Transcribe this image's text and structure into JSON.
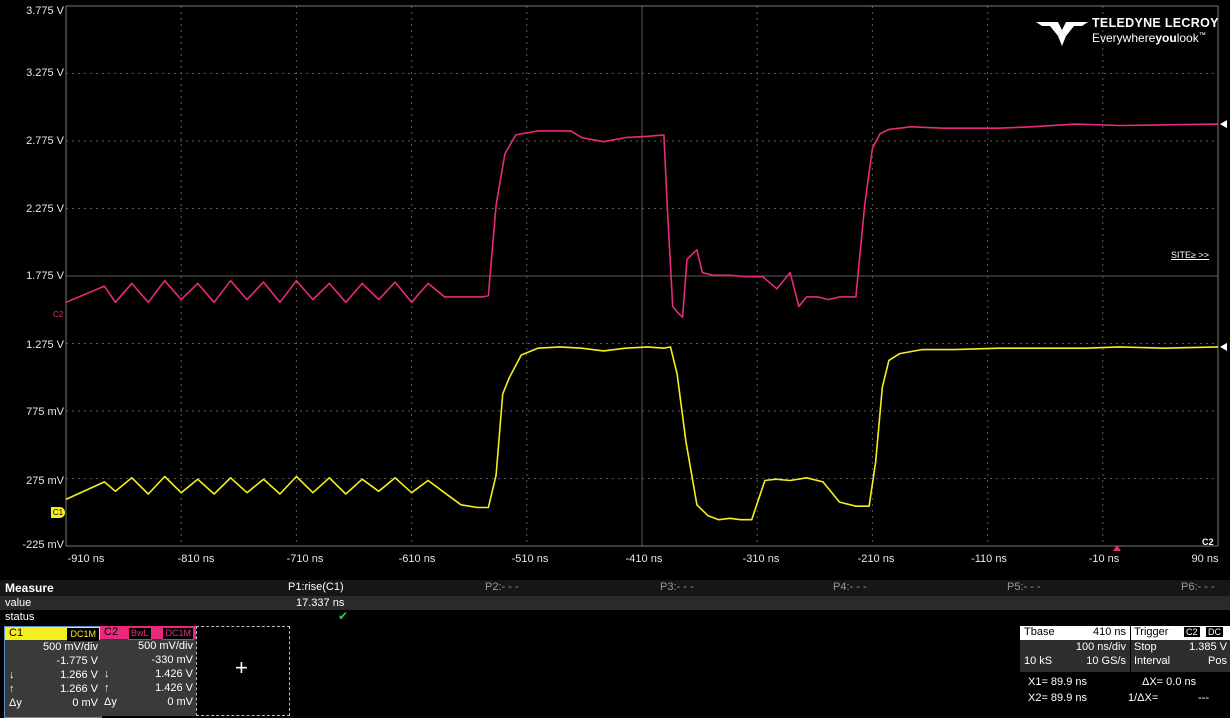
{
  "brand": {
    "name": "TELEDYNE LECROY",
    "tagline_pre": "Everywhere",
    "tagline_bold": "you",
    "tagline_post": "look",
    "tm": "™"
  },
  "axes": {
    "y_labels": [
      "3.775 V",
      "3.275 V",
      "2.775 V",
      "2.275 V",
      "1.775 V",
      "1.275 V",
      "775 mV",
      "275 mV",
      "-225 mV"
    ],
    "x_labels": [
      "-910 ns",
      "-810 ns",
      "-710 ns",
      "-610 ns",
      "-510 ns",
      "-410 ns",
      "-310 ns",
      "-210 ns",
      "-110 ns",
      "-10 ns",
      "90 ns"
    ]
  },
  "grid_link": "SITE≥ >>",
  "c2_tag": "C2",
  "c1_marker": "C1",
  "c2_marker": "C2",
  "colors": {
    "c1": "#f5ef1f",
    "c2": "#e8297e",
    "grid": "#5a5a5a"
  },
  "chart_data": {
    "type": "line",
    "xlabel": "",
    "ylabel": "",
    "x_unit": "ns",
    "xlim": [
      -960,
      90
    ],
    "ylim": [
      -0.225,
      3.775
    ],
    "grid": true,
    "series": [
      {
        "color": "#f5ef1f",
        "x": [
          -960,
          -925,
          -915,
          -900,
          -885,
          -870,
          -855,
          -840,
          -825,
          -810,
          -795,
          -780,
          -765,
          -750,
          -735,
          -720,
          -705,
          -690,
          -675,
          -660,
          -645,
          -630,
          -615,
          -600,
          -585,
          -575,
          -568,
          -562,
          -556,
          -545,
          -530,
          -510,
          -490,
          -470,
          -450,
          -430,
          -415,
          -409,
          -403,
          -395,
          -385,
          -375,
          -365,
          -355,
          -345,
          -335,
          -323,
          -313,
          -300,
          -285,
          -270,
          -255,
          -240,
          -228,
          -222,
          -216,
          -210,
          -200,
          -180,
          -150,
          -110,
          -70,
          -30,
          0,
          40,
          90
        ],
        "y": [
          0.12,
          0.25,
          0.18,
          0.28,
          0.16,
          0.29,
          0.17,
          0.27,
          0.16,
          0.28,
          0.17,
          0.27,
          0.16,
          0.29,
          0.17,
          0.28,
          0.16,
          0.27,
          0.18,
          0.28,
          0.17,
          0.26,
          0.17,
          0.08,
          0.06,
          0.06,
          0.3,
          0.9,
          1.02,
          1.19,
          1.24,
          1.25,
          1.24,
          1.22,
          1.24,
          1.25,
          1.24,
          1.25,
          1.05,
          0.55,
          0.08,
          0.0,
          -0.03,
          -0.02,
          -0.03,
          -0.03,
          0.26,
          0.27,
          0.26,
          0.28,
          0.25,
          0.1,
          0.07,
          0.07,
          0.4,
          0.95,
          1.15,
          1.2,
          1.23,
          1.23,
          1.24,
          1.24,
          1.24,
          1.25,
          1.24,
          1.25
        ]
      },
      {
        "color": "#e8297e",
        "x": [
          -960,
          -925,
          -915,
          -900,
          -885,
          -870,
          -855,
          -840,
          -825,
          -810,
          -795,
          -780,
          -765,
          -750,
          -735,
          -720,
          -705,
          -690,
          -675,
          -660,
          -645,
          -630,
          -615,
          -600,
          -585,
          -580,
          -575,
          -568,
          -560,
          -550,
          -530,
          -510,
          -500,
          -490,
          -470,
          -450,
          -430,
          -415,
          -412,
          -407,
          -402,
          -398,
          -394,
          -390,
          -385,
          -380,
          -370,
          -355,
          -340,
          -325,
          -312,
          -300,
          -292,
          -285,
          -275,
          -265,
          -255,
          -240,
          -232,
          -225,
          -218,
          -210,
          -190,
          -160,
          -130,
          -110,
          -80,
          -40,
          0,
          90
        ],
        "y": [
          1.58,
          1.7,
          1.58,
          1.72,
          1.58,
          1.74,
          1.6,
          1.72,
          1.58,
          1.74,
          1.6,
          1.73,
          1.58,
          1.74,
          1.6,
          1.72,
          1.58,
          1.72,
          1.6,
          1.73,
          1.58,
          1.72,
          1.62,
          1.62,
          1.62,
          1.62,
          1.63,
          2.3,
          2.68,
          2.82,
          2.85,
          2.85,
          2.85,
          2.8,
          2.77,
          2.8,
          2.81,
          2.82,
          2.3,
          1.55,
          1.5,
          1.47,
          1.9,
          1.93,
          1.97,
          1.8,
          1.78,
          1.78,
          1.77,
          1.77,
          1.68,
          1.8,
          1.55,
          1.62,
          1.62,
          1.6,
          1.62,
          1.62,
          2.3,
          2.72,
          2.83,
          2.86,
          2.88,
          2.87,
          2.87,
          2.87,
          2.88,
          2.9,
          2.89,
          2.9
        ]
      }
    ]
  },
  "measure": {
    "title": "Measure",
    "params": [
      "P1:rise(C1)",
      "P2:- - -",
      "P3:- - -",
      "P4:- - -",
      "P5:- - -",
      "P6:- - -"
    ],
    "value_label": "value",
    "status_label": "status",
    "p1_value": "17.337 ns",
    "p1_status": "✔"
  },
  "c1": {
    "name": "C1",
    "tags": [
      "DC1M"
    ],
    "vdiv": "500 mV/div",
    "offset": "-1.775 V",
    "cur1": "1.266 V",
    "cur2": "1.266 V",
    "dy": "0 mV",
    "sym1": "↓",
    "sym2": "↑",
    "sym3": "Δy"
  },
  "c2": {
    "name": "C2",
    "tags": [
      "BwL",
      "DC1M"
    ],
    "vdiv": "500 mV/div",
    "offset": "-330 mV",
    "cur1": "1.426 V",
    "cur2": "1.426 V",
    "dy": "0 mV",
    "sym1": "↓",
    "sym2": "↑",
    "sym3": "Δy"
  },
  "add_slot": "+",
  "timebase": {
    "label": "Tbase",
    "delay": "410 ns",
    "tdiv": "100 ns/div",
    "samples": "10 kS",
    "rate": "10 GS/s"
  },
  "trigger": {
    "label": "Trigger",
    "src": "C2",
    "coupling": "DC",
    "mode": "Stop",
    "level": "1.385 V",
    "type": "Interval",
    "slope": "Pos"
  },
  "cursors": {
    "x1": "X1=  89.9 ns",
    "dx": "ΔX=   0.0 ns",
    "x2": "X2=  89.9 ns",
    "inv_dx": "1/ΔX=",
    "inv_dx_val": "---"
  }
}
